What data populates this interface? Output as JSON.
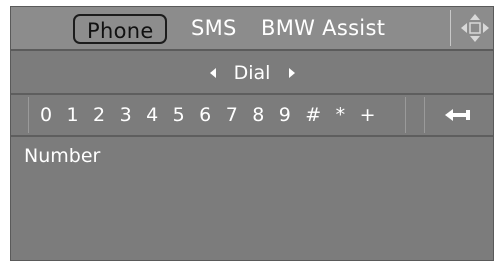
{
  "tabs": {
    "phone": "Phone",
    "sms": "SMS",
    "assist": "BMW Assist"
  },
  "icons": {
    "navigation": "directional-pad-icon",
    "backspace": "backspace-arrow-icon",
    "dial_prev": "arrow-left-icon",
    "dial_next": "arrow-right-icon"
  },
  "dial": {
    "label": "Dial"
  },
  "keypad": {
    "digits": "0 1 2 3 4 5 6 7 8 9 # * +"
  },
  "number": {
    "label": "Number"
  },
  "colors": {
    "screen_bg": "#7c7c7c",
    "selected_tab_border": "#1c1c1c",
    "text": "#ffffff"
  }
}
